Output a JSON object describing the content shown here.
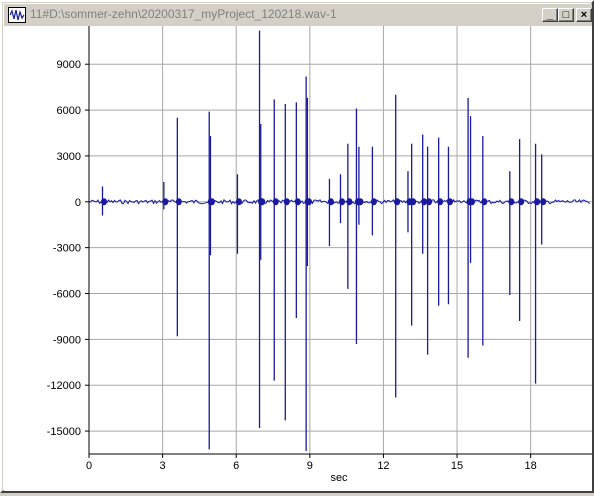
{
  "window": {
    "title": "11#D:\\sommer-zehn\\20200317_myProject_120218.wav-1",
    "minimize_label": "_",
    "maximize_label": "□",
    "close_label": "×"
  },
  "colors": {
    "waveform": "#1a1aa0",
    "grid": "#a8a8a8",
    "background": "#ffffff"
  },
  "chart_data": {
    "type": "line",
    "title": "",
    "xlabel": "sec",
    "ylabel": "",
    "xlim": [
      0,
      20.5
    ],
    "ylim": [
      -16500,
      11500
    ],
    "x_ticks": [
      0,
      3,
      6,
      9,
      12,
      15,
      18
    ],
    "x_tick_labels": [
      "0",
      "3",
      "6",
      "9",
      "12",
      "15",
      "18"
    ],
    "y_ticks": [
      9000,
      6000,
      3000,
      0,
      -3000,
      -6000,
      -9000,
      -12000,
      -15000
    ],
    "y_tick_labels": [
      "9000",
      "6000",
      "3000",
      "0",
      "-3000",
      "-6000",
      "-9000",
      "-12000",
      "-15000"
    ],
    "grid": true,
    "series": [
      {
        "spikes": [
          {
            "t": 0.55,
            "max": 1000,
            "min": -900
          },
          {
            "t": 3.05,
            "max": 1300,
            "min": -500
          },
          {
            "t": 3.6,
            "max": 5500,
            "min": -8800
          },
          {
            "t": 4.9,
            "max": 5900,
            "min": -16200
          },
          {
            "t": 4.95,
            "max": 4300,
            "min": -3500
          },
          {
            "t": 6.05,
            "max": 1800,
            "min": -3400
          },
          {
            "t": 6.95,
            "max": 11200,
            "min": -14800
          },
          {
            "t": 7.0,
            "max": 5100,
            "min": -3800
          },
          {
            "t": 7.55,
            "max": 6700,
            "min": -11700
          },
          {
            "t": 8.0,
            "max": 6400,
            "min": -14300
          },
          {
            "t": 8.45,
            "max": 6500,
            "min": -7600
          },
          {
            "t": 8.85,
            "max": 8200,
            "min": -16300
          },
          {
            "t": 8.9,
            "max": 6800,
            "min": -4200
          },
          {
            "t": 9.8,
            "max": 1500,
            "min": -2900
          },
          {
            "t": 10.25,
            "max": 1800,
            "min": -1400
          },
          {
            "t": 10.55,
            "max": 3800,
            "min": -5700
          },
          {
            "t": 10.9,
            "max": 6100,
            "min": -9300
          },
          {
            "t": 11.0,
            "max": 3600,
            "min": -1500
          },
          {
            "t": 11.55,
            "max": 3600,
            "min": -2200
          },
          {
            "t": 12.5,
            "max": 7000,
            "min": -12800
          },
          {
            "t": 13.0,
            "max": 2000,
            "min": -2000
          },
          {
            "t": 13.15,
            "max": 3800,
            "min": -8100
          },
          {
            "t": 13.6,
            "max": 4400,
            "min": -3400
          },
          {
            "t": 13.8,
            "max": 3600,
            "min": -10000
          },
          {
            "t": 14.25,
            "max": 4200,
            "min": -6800
          },
          {
            "t": 14.65,
            "max": 3600,
            "min": -6700
          },
          {
            "t": 15.45,
            "max": 6800,
            "min": -10200
          },
          {
            "t": 15.55,
            "max": 5600,
            "min": -4000
          },
          {
            "t": 16.05,
            "max": 4300,
            "min": -9400
          },
          {
            "t": 17.15,
            "max": 2000,
            "min": -6100
          },
          {
            "t": 17.55,
            "max": 4100,
            "min": -7800
          },
          {
            "t": 18.2,
            "max": 3800,
            "min": -11900
          },
          {
            "t": 18.45,
            "max": 3100,
            "min": -2800
          }
        ]
      }
    ]
  }
}
